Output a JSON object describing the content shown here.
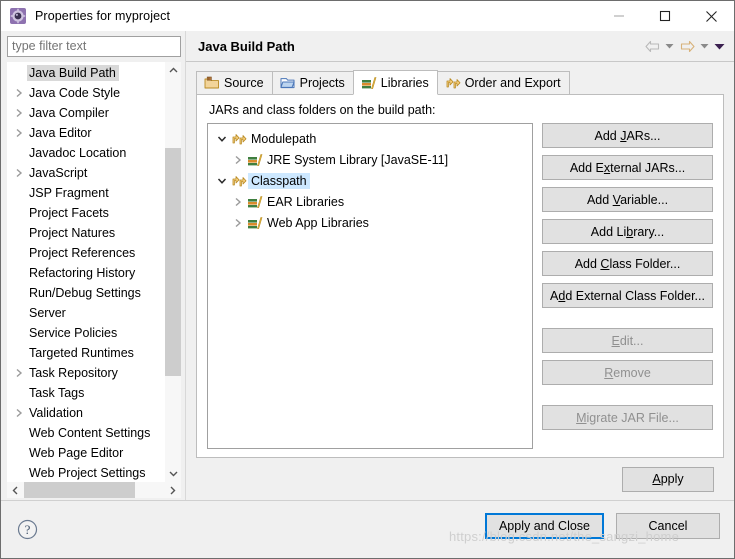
{
  "window": {
    "title": "Properties for myproject",
    "icon": "eclipse-properties-icon",
    "controls": {
      "minimize": "minimize-icon",
      "maximize": "maximize-icon",
      "close": "close-icon"
    }
  },
  "sidebar": {
    "filter": {
      "placeholder": "type filter text",
      "value": ""
    },
    "items": [
      {
        "label": "Java Build Path",
        "expandable": false,
        "selected": true
      },
      {
        "label": "Java Code Style",
        "expandable": true,
        "selected": false
      },
      {
        "label": "Java Compiler",
        "expandable": true,
        "selected": false
      },
      {
        "label": "Java Editor",
        "expandable": true,
        "selected": false
      },
      {
        "label": "Javadoc Location",
        "expandable": false,
        "selected": false
      },
      {
        "label": "JavaScript",
        "expandable": true,
        "selected": false
      },
      {
        "label": "JSP Fragment",
        "expandable": false,
        "selected": false
      },
      {
        "label": "Project Facets",
        "expandable": false,
        "selected": false
      },
      {
        "label": "Project Natures",
        "expandable": false,
        "selected": false
      },
      {
        "label": "Project References",
        "expandable": false,
        "selected": false
      },
      {
        "label": "Refactoring History",
        "expandable": false,
        "selected": false
      },
      {
        "label": "Run/Debug Settings",
        "expandable": false,
        "selected": false
      },
      {
        "label": "Server",
        "expandable": false,
        "selected": false
      },
      {
        "label": "Service Policies",
        "expandable": false,
        "selected": false
      },
      {
        "label": "Targeted Runtimes",
        "expandable": false,
        "selected": false
      },
      {
        "label": "Task Repository",
        "expandable": true,
        "selected": false
      },
      {
        "label": "Task Tags",
        "expandable": false,
        "selected": false
      },
      {
        "label": "Validation",
        "expandable": true,
        "selected": false
      },
      {
        "label": "Web Content Settings",
        "expandable": false,
        "selected": false
      },
      {
        "label": "Web Page Editor",
        "expandable": false,
        "selected": false
      },
      {
        "label": "Web Project Settings",
        "expandable": false,
        "selected": false
      }
    ]
  },
  "page": {
    "title": "Java Build Path",
    "nav": {
      "back": "back-arrow-icon",
      "back_dropdown": "chevron-down-icon",
      "forward": "forward-arrow-icon",
      "forward_dropdown": "chevron-down-icon",
      "menu": "view-menu-icon"
    },
    "tabs": [
      {
        "label": "Source",
        "icon": "source-folder-icon",
        "active": false
      },
      {
        "label": "Projects",
        "icon": "projects-folder-icon",
        "active": false
      },
      {
        "label": "Libraries",
        "icon": "libraries-books-icon",
        "active": true
      },
      {
        "label": "Order and Export",
        "icon": "order-export-icon",
        "active": false
      }
    ],
    "panel_label": "JARs and class folders on the build path:",
    "tree": [
      {
        "label": "Modulepath",
        "icon": "modulepath-icon",
        "level": 0,
        "twisty": "expanded",
        "selected": false
      },
      {
        "label": "JRE System Library [JavaSE-11]",
        "icon": "library-books-icon",
        "level": 1,
        "twisty": "collapsed",
        "selected": false
      },
      {
        "label": "Classpath",
        "icon": "classpath-icon",
        "level": 0,
        "twisty": "expanded",
        "selected": true
      },
      {
        "label": "EAR Libraries",
        "icon": "library-books-icon",
        "level": 1,
        "twisty": "collapsed",
        "selected": false
      },
      {
        "label": "Web App Libraries",
        "icon": "library-books-icon",
        "level": 1,
        "twisty": "collapsed",
        "selected": false
      }
    ],
    "buttons": [
      {
        "label": "Add JARs...",
        "mnemonic": "J",
        "disabled": false,
        "gap": false
      },
      {
        "label": "Add External JARs...",
        "mnemonic": "x",
        "disabled": false,
        "gap": false
      },
      {
        "label": "Add Variable...",
        "mnemonic": "V",
        "disabled": false,
        "gap": false
      },
      {
        "label": "Add Library...",
        "mnemonic": "b",
        "disabled": false,
        "gap": false
      },
      {
        "label": "Add Class Folder...",
        "mnemonic": "C",
        "disabled": false,
        "gap": false
      },
      {
        "label": "Add External Class Folder...",
        "mnemonic": "d",
        "disabled": false,
        "gap": false
      },
      {
        "label": "Edit...",
        "mnemonic": "E",
        "disabled": true,
        "gap": true
      },
      {
        "label": "Remove",
        "mnemonic": "R",
        "disabled": true,
        "gap": false
      },
      {
        "label": "Migrate JAR File...",
        "mnemonic": "M",
        "disabled": true,
        "gap": true
      }
    ],
    "apply_label": "Apply"
  },
  "footer": {
    "help_icon": "help-question-icon",
    "apply_and_close": "Apply and Close",
    "cancel": "Cancel"
  },
  "watermark": "https://blog.csdn.net/the_sangzi_home",
  "colors": {
    "selection_blue": "#cde8ff",
    "focus_blue": "#0078d7",
    "dialog_bg": "#f0f0f0",
    "button_bg": "#e1e1e1"
  }
}
